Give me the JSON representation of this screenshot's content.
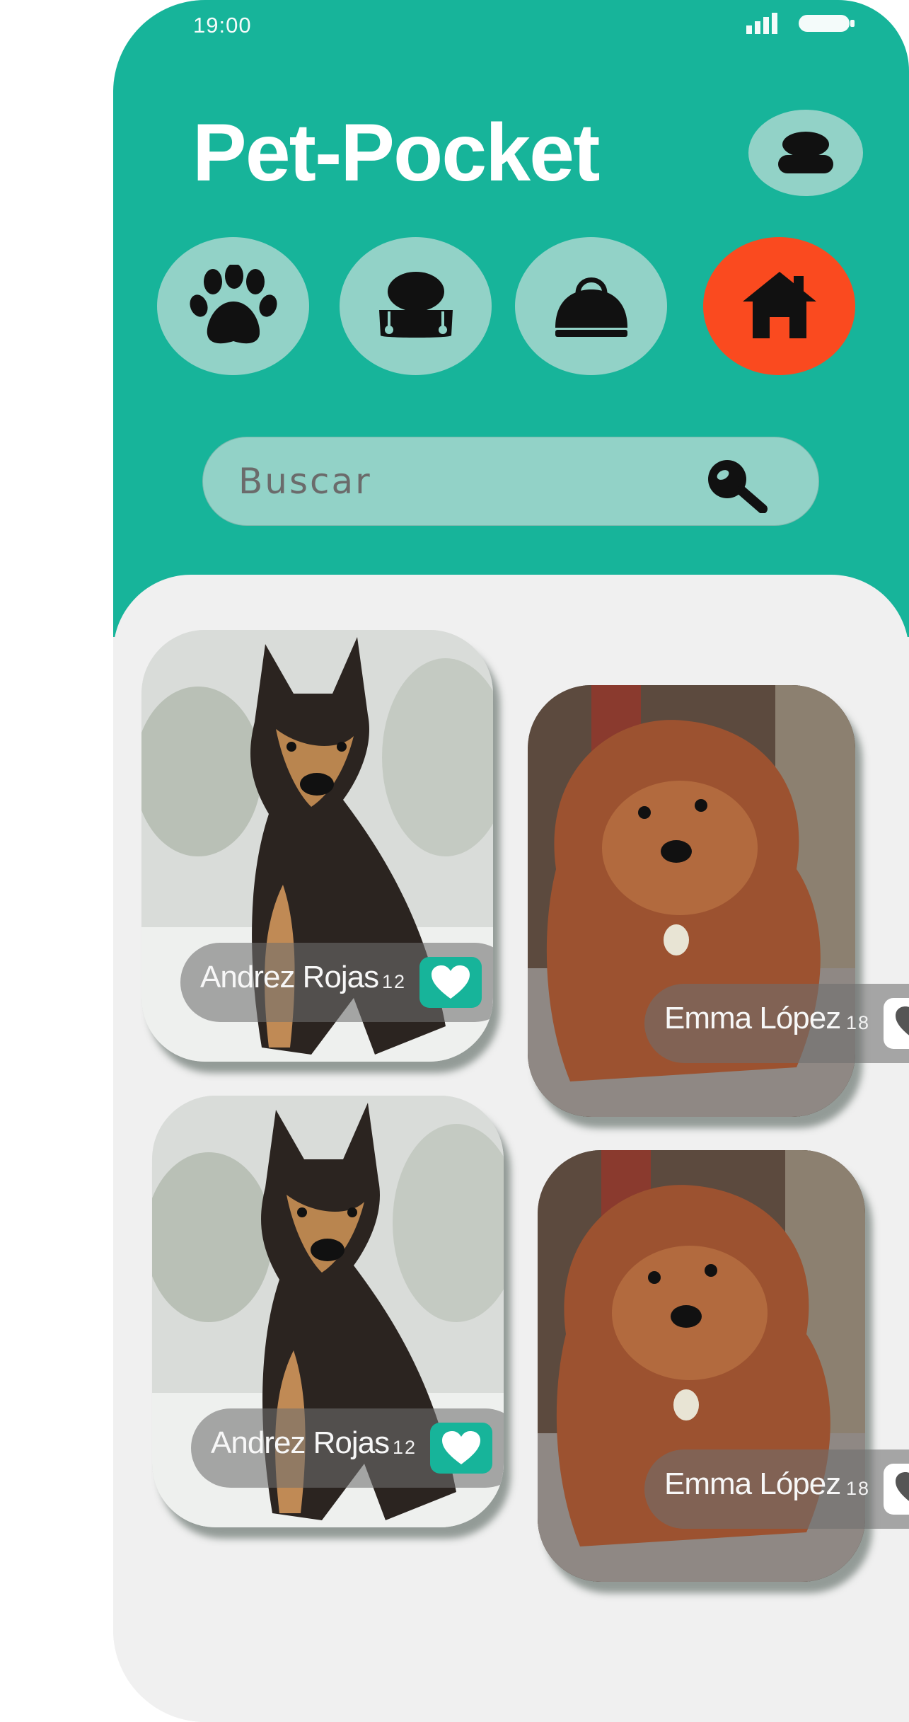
{
  "status_bar": {
    "time": "19:00"
  },
  "app": {
    "title": "Pet-Pocket"
  },
  "categories": [
    {
      "icon": "paw-icon",
      "active": false
    },
    {
      "icon": "pet-bowl-icon",
      "active": false
    },
    {
      "icon": "carrier-bag-icon",
      "active": false
    },
    {
      "icon": "house-icon",
      "active": true
    }
  ],
  "search": {
    "placeholder": "Buscar"
  },
  "posts": [
    {
      "author": "Andrez Rojas",
      "likes": "12",
      "liked": true
    },
    {
      "author": "Emma López",
      "likes": "18",
      "liked": false
    },
    {
      "author": "Andrez Rojas",
      "likes": "12",
      "liked": true
    },
    {
      "author": "Emma López",
      "likes": "18",
      "liked": false
    }
  ],
  "colors": {
    "primary": "#17b49a",
    "accent": "#fa4a1f",
    "chip": "#92d2c7",
    "background": "#f0f0f0"
  }
}
